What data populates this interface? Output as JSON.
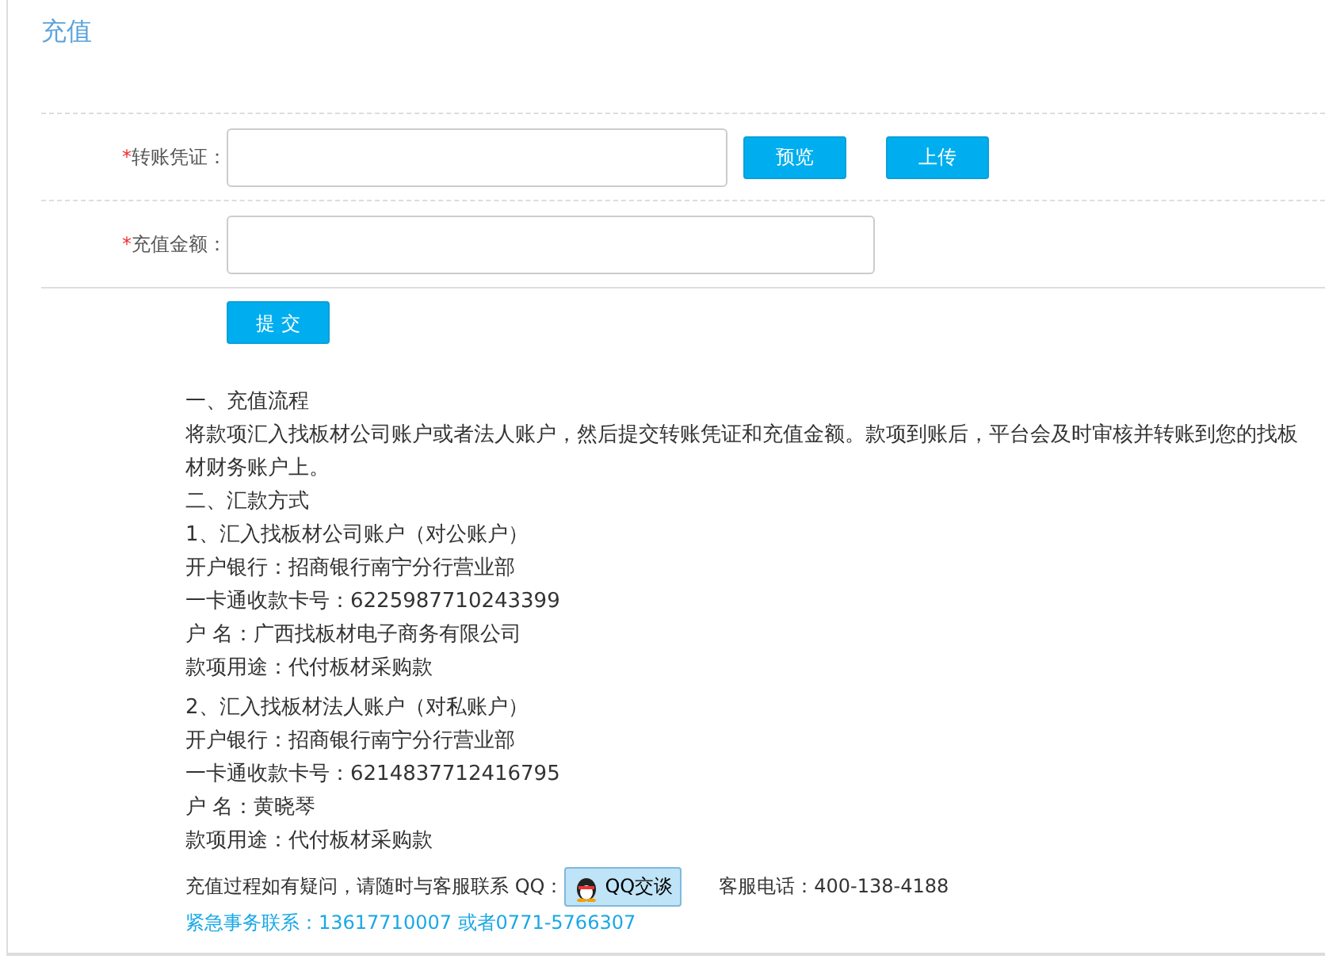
{
  "title": "充值",
  "fields": [
    {
      "kind": "upload",
      "required_mark": "*",
      "label": "转账凭证：",
      "buttons": [
        "预览",
        "上传"
      ]
    },
    {
      "kind": "amount",
      "required_mark": "*",
      "label": "充值金额："
    }
  ],
  "submit": "提 交",
  "instructions": [
    {
      "lines": [
        "一、充值流程",
        "将款项汇入找板材公司账户或者法人账户，然后提交转账凭证和充值金额。款项到账后，平台会及时审核并转账到您的找板材财务账户上。",
        "二、汇款方式",
        "1、汇入找板材公司账户（对公账户）",
        "开户银行：招商银行南宁分行营业部",
        "一卡通收款卡号：6225987710243399",
        "户 名：广西找板材电子商务有限公司",
        "款项用途：代付板材采购款"
      ]
    },
    {
      "lines": [
        "2、汇入找板材法人账户（对私账户）",
        "开户银行：招商银行南宁分行营业部",
        "一卡通收款卡号：6214837712416795",
        "户 名：黄晓琴",
        "款项用途：代付板材采购款"
      ]
    }
  ],
  "contact": {
    "text": "充值过程如有疑问，请随时与客服联系 QQ：",
    "qq_button": "QQ交谈",
    "phone": "客服电话：400-138-4188",
    "urgent": "紧急事务联系：13617710007 或者0771-5766307"
  }
}
